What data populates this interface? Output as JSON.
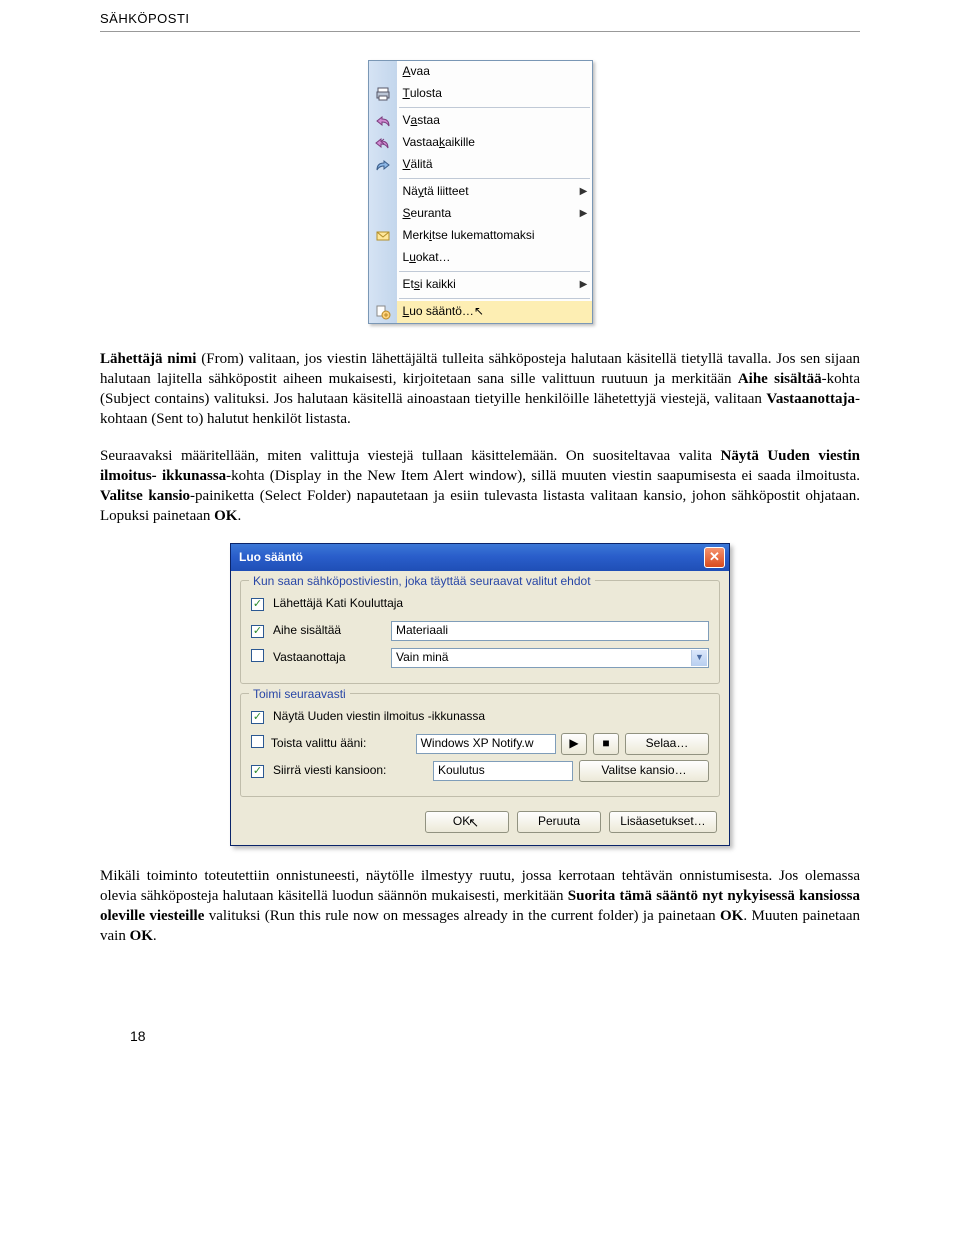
{
  "header": {
    "title": "SÄHKÖPOSTI"
  },
  "contextMenu": {
    "items": [
      {
        "label": "Avaa",
        "underlineHtml": "<span class='underline'>A</span>vaa",
        "icon": null,
        "sub": false
      },
      {
        "label": "Tulosta",
        "underlineHtml": "<span class='underline'>T</span>ulosta",
        "icon": "printer",
        "sub": false
      },
      {
        "sep": true
      },
      {
        "label": "Vastaa",
        "underlineHtml": "V<span class='underline'>a</span>staa",
        "icon": "reply",
        "sub": false
      },
      {
        "label": "Vastaa kaikille",
        "underlineHtml": "Vastaa <span class='underline'>k</span>aikille",
        "icon": "replyall",
        "sub": false
      },
      {
        "label": "Välitä",
        "underlineHtml": "<span class='underline'>V</span>älitä",
        "icon": "forward",
        "sub": false
      },
      {
        "sep": true
      },
      {
        "label": "Näytä liitteet",
        "underlineHtml": "Nä<span class='underline'>y</span>tä liitteet",
        "icon": null,
        "sub": true
      },
      {
        "label": "Seuranta",
        "underlineHtml": "<span class='underline'>S</span>euranta",
        "icon": null,
        "sub": true
      },
      {
        "label": "Merkitse lukemattomaksi",
        "underlineHtml": "Merk<span class='underline'>i</span>tse lukemattomaksi",
        "icon": "envelope",
        "sub": false
      },
      {
        "label": "Luokat…",
        "underlineHtml": "L<span class='underline'>u</span>okat…",
        "icon": null,
        "sub": false
      },
      {
        "sep": true
      },
      {
        "label": "Etsi kaikki",
        "underlineHtml": "Et<span class='underline'>s</span>i kaikki",
        "icon": null,
        "sub": true
      },
      {
        "sep": true
      },
      {
        "label": "Luo sääntö…",
        "underlineHtml": "<span class='underline'>L</span>uo sääntö…",
        "icon": "rule",
        "sub": false,
        "highlight": true
      }
    ]
  },
  "para1": {
    "seg0": "Lähettäjä nimi",
    "seg1": " (From) valitaan, jos viestin lähettäjältä tulleita sähköposteja halutaan käsitellä tietyllä tavalla. Jos sen sijaan halutaan lajitella sähköpostit aiheen mukaisesti, kirjoitetaan sana sille valittuun ruutuun ja merkitään ",
    "seg2": "Aihe sisältää",
    "seg3": "-kohta (Subject contains) valituksi. Jos halutaan käsitellä ainoastaan tietyille henkilöille lähetettyjä viestejä, valitaan ",
    "seg4": "Vastaanottaja",
    "seg5": "-kohtaan (Sent to) halutut henkilöt listasta."
  },
  "para2": {
    "seg0": "Seuraavaksi määritellään, miten valittuja viestejä tullaan käsittelemään. On suositeltavaa valita ",
    "seg1": "Näytä Uuden viestin ilmoitus- ikkunassa",
    "seg2": "-kohta (Display in the New Item Alert window), sillä muuten viestin saapumisesta ei saada ilmoitusta. ",
    "seg3": "Valitse kansio",
    "seg4": "-painiketta (Select Folder) napautetaan ja esiin tulevasta listasta valitaan kansio, johon sähköpostit ohjataan. Lopuksi painetaan ",
    "seg5": "OK",
    "seg6": "."
  },
  "dialog": {
    "title": "Luo sääntö",
    "group1Legend": "Kun saan sähköpostiviestin, joka täyttää seuraavat valitut ehdot",
    "row_sender": {
      "checked": true,
      "label": "Lähettäjä Kati Kouluttaja"
    },
    "row_subject": {
      "checked": true,
      "label": "Aihe sisältää",
      "value": "Materiaali"
    },
    "row_recipient": {
      "checked": false,
      "label": "Vastaanottaja",
      "value": "Vain minä"
    },
    "group2Legend": "Toimi seuraavasti",
    "row_alert": {
      "checked": true,
      "label": "Näytä Uuden viestin ilmoitus -ikkunassa"
    },
    "row_sound": {
      "checked": false,
      "label": "Toista valittu ääni:",
      "value": "Windows XP Notify.w",
      "browse": "Selaa…"
    },
    "row_move": {
      "checked": true,
      "label": "Siirrä viesti kansioon:",
      "value": "Koulutus",
      "browse": "Valitse kansio…"
    },
    "buttons": {
      "ok": "OK",
      "cancel": "Peruuta",
      "advanced": "Lisäasetukset…"
    }
  },
  "para3": {
    "seg0": "Mikäli toiminto toteutettiin onnistuneesti, näytölle ilmestyy ruutu, jossa kerrotaan tehtävän onnistumisesta. Jos olemassa olevia sähköposteja halutaan käsitellä luodun säännön mukaisesti, merkitään ",
    "seg1": "Suorita tämä sääntö nyt nykyisessä kansiossa oleville viesteille",
    "seg2": " valituksi (Run this rule now on messages already in the current folder) ja painetaan ",
    "seg3": "OK",
    "seg4": ". Muuten painetaan vain ",
    "seg5": "OK",
    "seg6": "."
  },
  "pageNumber": "18"
}
